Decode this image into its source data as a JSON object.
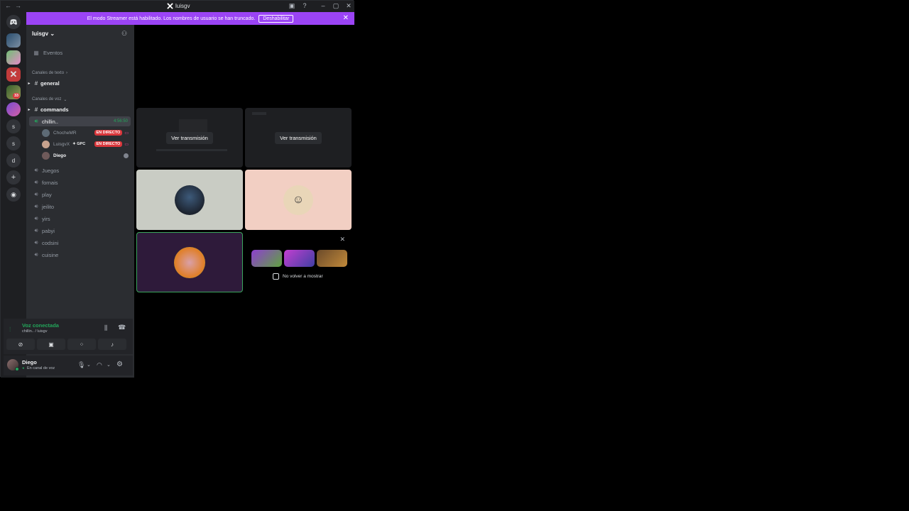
{
  "titlebar": {
    "back": "←",
    "forward": "→",
    "title": "luisgv",
    "inbox_icon": "inbox-icon",
    "help_icon": "help-icon",
    "minimize": "–",
    "maximize": "▢",
    "close": "✕"
  },
  "banner": {
    "text": "El modo Streamer está habilitado. Los nombres de usuario se han truncado.",
    "button": "Deshabilitar",
    "close": "✕"
  },
  "rail": {
    "servers": [
      "",
      "",
      "",
      "33",
      "",
      "s",
      "s",
      "d",
      "",
      ""
    ],
    "badge": "33"
  },
  "sidebar": {
    "server_name": "luisgv",
    "events": "Eventos",
    "text_category": "Canales de texto",
    "text_channels": [
      "general"
    ],
    "voice_category": "Canales de voz",
    "commands": "commands",
    "active_voice": {
      "name": "chillin..",
      "timer": "4:56:50"
    },
    "voice_members": [
      {
        "name": "ChocheMR",
        "badge": "EN DIRECTO",
        "extra": ""
      },
      {
        "name": "LuisgvX",
        "badge": "EN DIRECTO",
        "extra": "✦ GPC"
      },
      {
        "name": "Diego",
        "badge": "",
        "extra": ""
      }
    ],
    "voice_channels": [
      "Juegos",
      "fornais",
      "play",
      "jeilito",
      "yirs",
      "pabyi",
      "codsini",
      "cuisine"
    ]
  },
  "voice_panel": {
    "status": "Voz conectada",
    "location": "chillin.. / luisgv"
  },
  "userbar": {
    "name": "Diego",
    "status": "En canal de voz"
  },
  "stage": {
    "stream_button_1": "Ver transmisión",
    "stream_button_2": "Ver transmisión",
    "tile_colors": {
      "top_left": "#1e1f22",
      "top_right": "#1e1f22",
      "mid_left": "#c9ccc4",
      "mid_right": "#f2cfc3",
      "bottom_left": "#2e1a3a",
      "bottom_left_border": "#3ba55d"
    },
    "promo_close": "✕",
    "checkbox_label": "No volver a mostrar"
  },
  "colors": {
    "accent": "#9b44f5",
    "live": "#da373c",
    "online": "#23a55a"
  }
}
